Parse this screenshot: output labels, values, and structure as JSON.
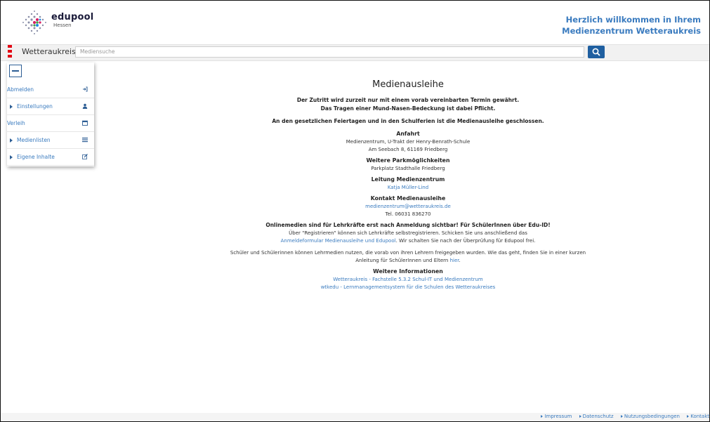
{
  "header": {
    "logo_name": "edupool",
    "logo_sub": "Hessen",
    "welcome_line1": "Herzlich willkommen in Ihrem",
    "welcome_line2": "Medienzentrum Wetteraukreis"
  },
  "search": {
    "region": "Wetteraukreis",
    "placeholder": "Mediensuche",
    "icon": "search-icon"
  },
  "sidebar": {
    "items": [
      {
        "label": "Abmelden",
        "icon": "logout-icon",
        "type": "top"
      },
      {
        "label": "Einstellungen",
        "icon": "user-icon",
        "type": "sub"
      },
      {
        "label": "Verleih",
        "icon": "calendar-icon",
        "type": "top"
      },
      {
        "label": "Medienlisten",
        "icon": "list-icon",
        "type": "sub"
      },
      {
        "label": "Eigene Inhalte",
        "icon": "edit-icon",
        "type": "sub"
      }
    ]
  },
  "main": {
    "title": "Medienausleihe",
    "notice1": "Der Zutritt wird zurzeit nur mit einem vorab vereinbarten Termin gewährt.",
    "notice2": "Das Tragen einer Mund-Nasen-Bedeckung ist dabei Pflicht.",
    "holiday": "An den gesetzlichen Feiertagen und in den Schulferien ist die Medienausleihe geschlossen.",
    "anfahrt_title": "Anfahrt",
    "anfahrt_line1": "Medienzentrum, U-Trakt der Henry-Benrath-Schule",
    "anfahrt_line2": "Am Seebach 8, 61169 Friedberg",
    "park_title": "Weitere Parkmöglichkeiten",
    "park_line": "Parkplatz Stadthalle Friedberg",
    "leitung_title": "Leitung Medienzentrum",
    "leitung_name": "Katja Müller-Lind",
    "kontakt_title": "Kontakt Medienausleihe",
    "kontakt_email": "medienzentrum@wetteraukreis.de",
    "kontakt_tel": "Tel. 06031 836270",
    "online_title": "Onlinemedien sind für Lehrkräfte erst nach Anmeldung sichtbar! Für SchülerInnen über Edu-ID!",
    "online_line1": "Über \"Registrieren\" können sich Lehrkräfte selbstregistrieren. Schicken Sie uns anschließend das",
    "online_link": "Anmeldeformular Medienausleihe und Edupool",
    "online_line2_rest": ". Wir schalten Sie nach der Überprüfung für Edupool frei.",
    "schueler_line1": "Schüler und Schülerinnen können Lehrmedien nutzen, die vorab von ihren Lehrern freigegeben wurden. Wie das geht, finden Sie in einer kurzen",
    "schueler_line2": "Anleitung für SchülerInnen und Eltern",
    "schueler_link": "hier",
    "info_title": "Weitere Informationen",
    "info_link1": "Wetteraukreis - Fachstelle 5.3.2 Schul-IT und Medienzentrum",
    "info_link2": "wtkedu - Lernmanagementsystem für die Schulen des Wetteraukreises"
  },
  "footer": {
    "links": [
      "Impressum",
      "Datenschutz",
      "Nutzungsbedingungen",
      "Kontakt"
    ]
  },
  "colors": {
    "accent": "#1f5fa0",
    "link": "#3a7bbf",
    "brand_red": "#e30613"
  }
}
